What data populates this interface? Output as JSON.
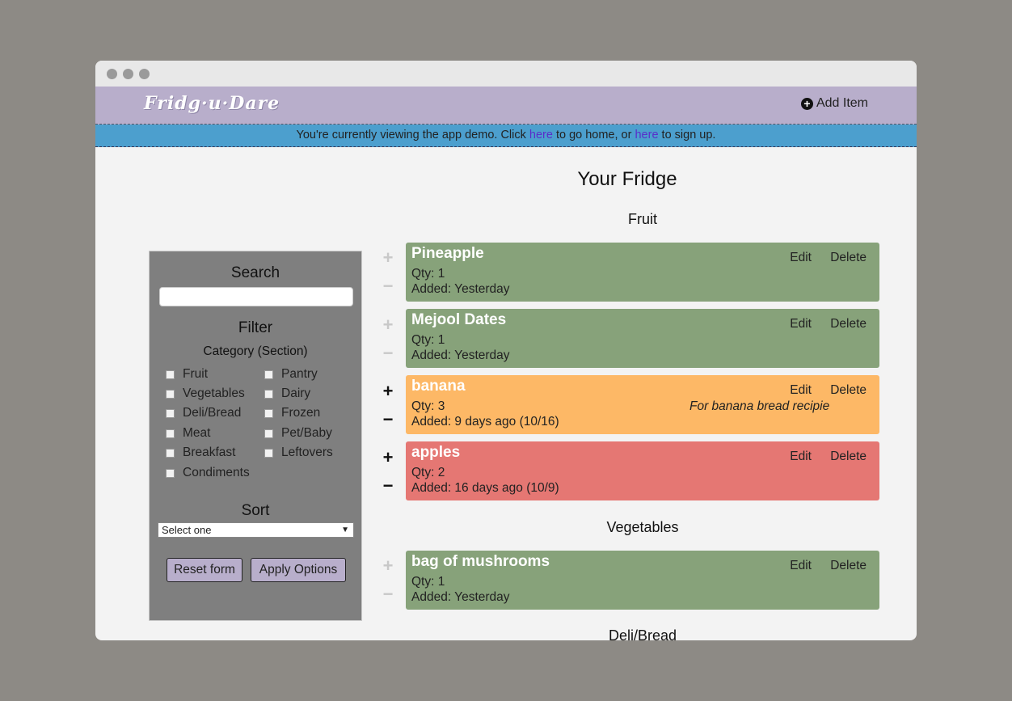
{
  "app": {
    "logo": "Fridg·u·Dare",
    "add_item_label": "Add Item"
  },
  "banner": {
    "text_before": "You're currently viewing the app demo. Click ",
    "link1": "here",
    "text_middle": " to go home, or ",
    "link2": "here",
    "text_after": " to sign up."
  },
  "main": {
    "title": "Your Fridge",
    "sections": [
      {
        "name": "Fruit",
        "items": [
          {
            "name": "Pineapple",
            "qty": "Qty: 1",
            "added": "Added: Yesterday",
            "note": "",
            "color": "#87a27a"
          },
          {
            "name": "Mejool Dates",
            "qty": "Qty: 1",
            "added": "Added: Yesterday",
            "note": "",
            "color": "#87a27a"
          },
          {
            "name": "banana",
            "qty": "Qty: 3",
            "added": "Added: 9 days ago (10/16)",
            "note": "For banana bread recipie",
            "color": "#fdb866"
          },
          {
            "name": "apples",
            "qty": "Qty: 2",
            "added": "Added: 16 days ago (10/9)",
            "note": "",
            "color": "#e57773"
          }
        ]
      },
      {
        "name": "Vegetables",
        "items": [
          {
            "name": "bag of mushrooms",
            "qty": "Qty: 1",
            "added": "Added: Yesterday",
            "note": "",
            "color": "#87a27a"
          }
        ]
      },
      {
        "name": "Deli/Bread",
        "items": []
      }
    ],
    "edit_label": "Edit",
    "delete_label": "Delete",
    "plus": "+",
    "minus": "−"
  },
  "sidebar": {
    "search_heading": "Search",
    "filter_heading": "Filter",
    "category_heading": "Category (Section)",
    "categories_left": [
      "Fruit",
      "Vegetables",
      "Deli/Bread",
      "Meat",
      "Breakfast",
      "Condiments"
    ],
    "categories_right": [
      "Pantry",
      "Dairy",
      "Frozen",
      "Pet/Baby",
      "Leftovers"
    ],
    "sort_heading": "Sort",
    "sort_selected": "Select one",
    "reset_label": "Reset form",
    "apply_label": "Apply Options"
  }
}
